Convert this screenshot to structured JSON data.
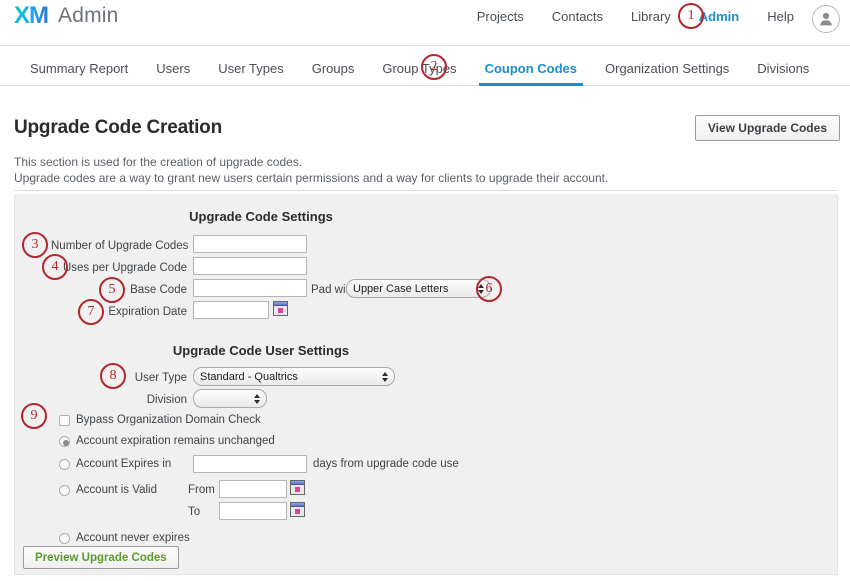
{
  "header": {
    "logo_text": "XM",
    "brand_word": "Admin",
    "nav": [
      {
        "label": "Projects",
        "active": false
      },
      {
        "label": "Contacts",
        "active": false
      },
      {
        "label": "Library",
        "active": false
      },
      {
        "label": "Admin",
        "active": true
      },
      {
        "label": "Help",
        "active": false
      }
    ],
    "avatar_icon": "user-avatar-icon"
  },
  "tabs": [
    {
      "label": "Summary Report",
      "active": false
    },
    {
      "label": "Users",
      "active": false
    },
    {
      "label": "User Types",
      "active": false
    },
    {
      "label": "Groups",
      "active": false
    },
    {
      "label": "Group Types",
      "active": false
    },
    {
      "label": "Coupon Codes",
      "active": true
    },
    {
      "label": "Organization Settings",
      "active": false
    },
    {
      "label": "Divisions",
      "active": false
    }
  ],
  "page": {
    "title": "Upgrade Code Creation",
    "view_codes_button": "View Upgrade Codes",
    "intro_line1": "This section is used for the creation of upgrade codes.",
    "intro_line2": "Upgrade codes are a way to grant new users certain permissions and a way for clients to upgrade their account."
  },
  "code_settings": {
    "heading": "Upgrade Code Settings",
    "number_of_codes_label": "Number of Upgrade Codes",
    "number_of_codes_value": "",
    "uses_per_code_label": "Uses per Upgrade Code",
    "uses_per_code_value": "",
    "base_code_label": "Base Code",
    "base_code_value": "",
    "pad_with_label": "Pad with",
    "pad_with_value": "Upper Case Letters",
    "expiration_date_label": "Expiration Date",
    "expiration_date_value": "",
    "calendar_icon": "calendar-icon"
  },
  "user_settings": {
    "heading": "Upgrade Code User Settings",
    "user_type_label": "User Type",
    "user_type_value": "Standard - Qualtrics",
    "division_label": "Division",
    "division_value": "",
    "bypass_label": "Bypass Organization Domain Check",
    "bypass_checked": false,
    "radio_unchanged_label": "Account expiration remains unchanged",
    "radio_expires_in_label": "Account Expires in",
    "expires_in_value": "",
    "expires_in_suffix": "days from upgrade code use",
    "radio_valid_label": "Account is Valid",
    "from_label": "From",
    "from_value": "",
    "to_label": "To",
    "to_value": "",
    "radio_never_label": "Account never expires",
    "selected_radio": "unchanged",
    "preview_button": "Preview Upgrade Codes"
  },
  "annotations": [
    {
      "n": "1"
    },
    {
      "n": "2"
    },
    {
      "n": "3"
    },
    {
      "n": "4"
    },
    {
      "n": "5"
    },
    {
      "n": "6"
    },
    {
      "n": "7"
    },
    {
      "n": "8"
    },
    {
      "n": "9"
    }
  ],
  "colors": {
    "accent_blue": "#1a8fd1",
    "annotation_red": "#b3262c",
    "button_green": "#5b9b2e",
    "panel_gray": "#f0f0f0"
  }
}
